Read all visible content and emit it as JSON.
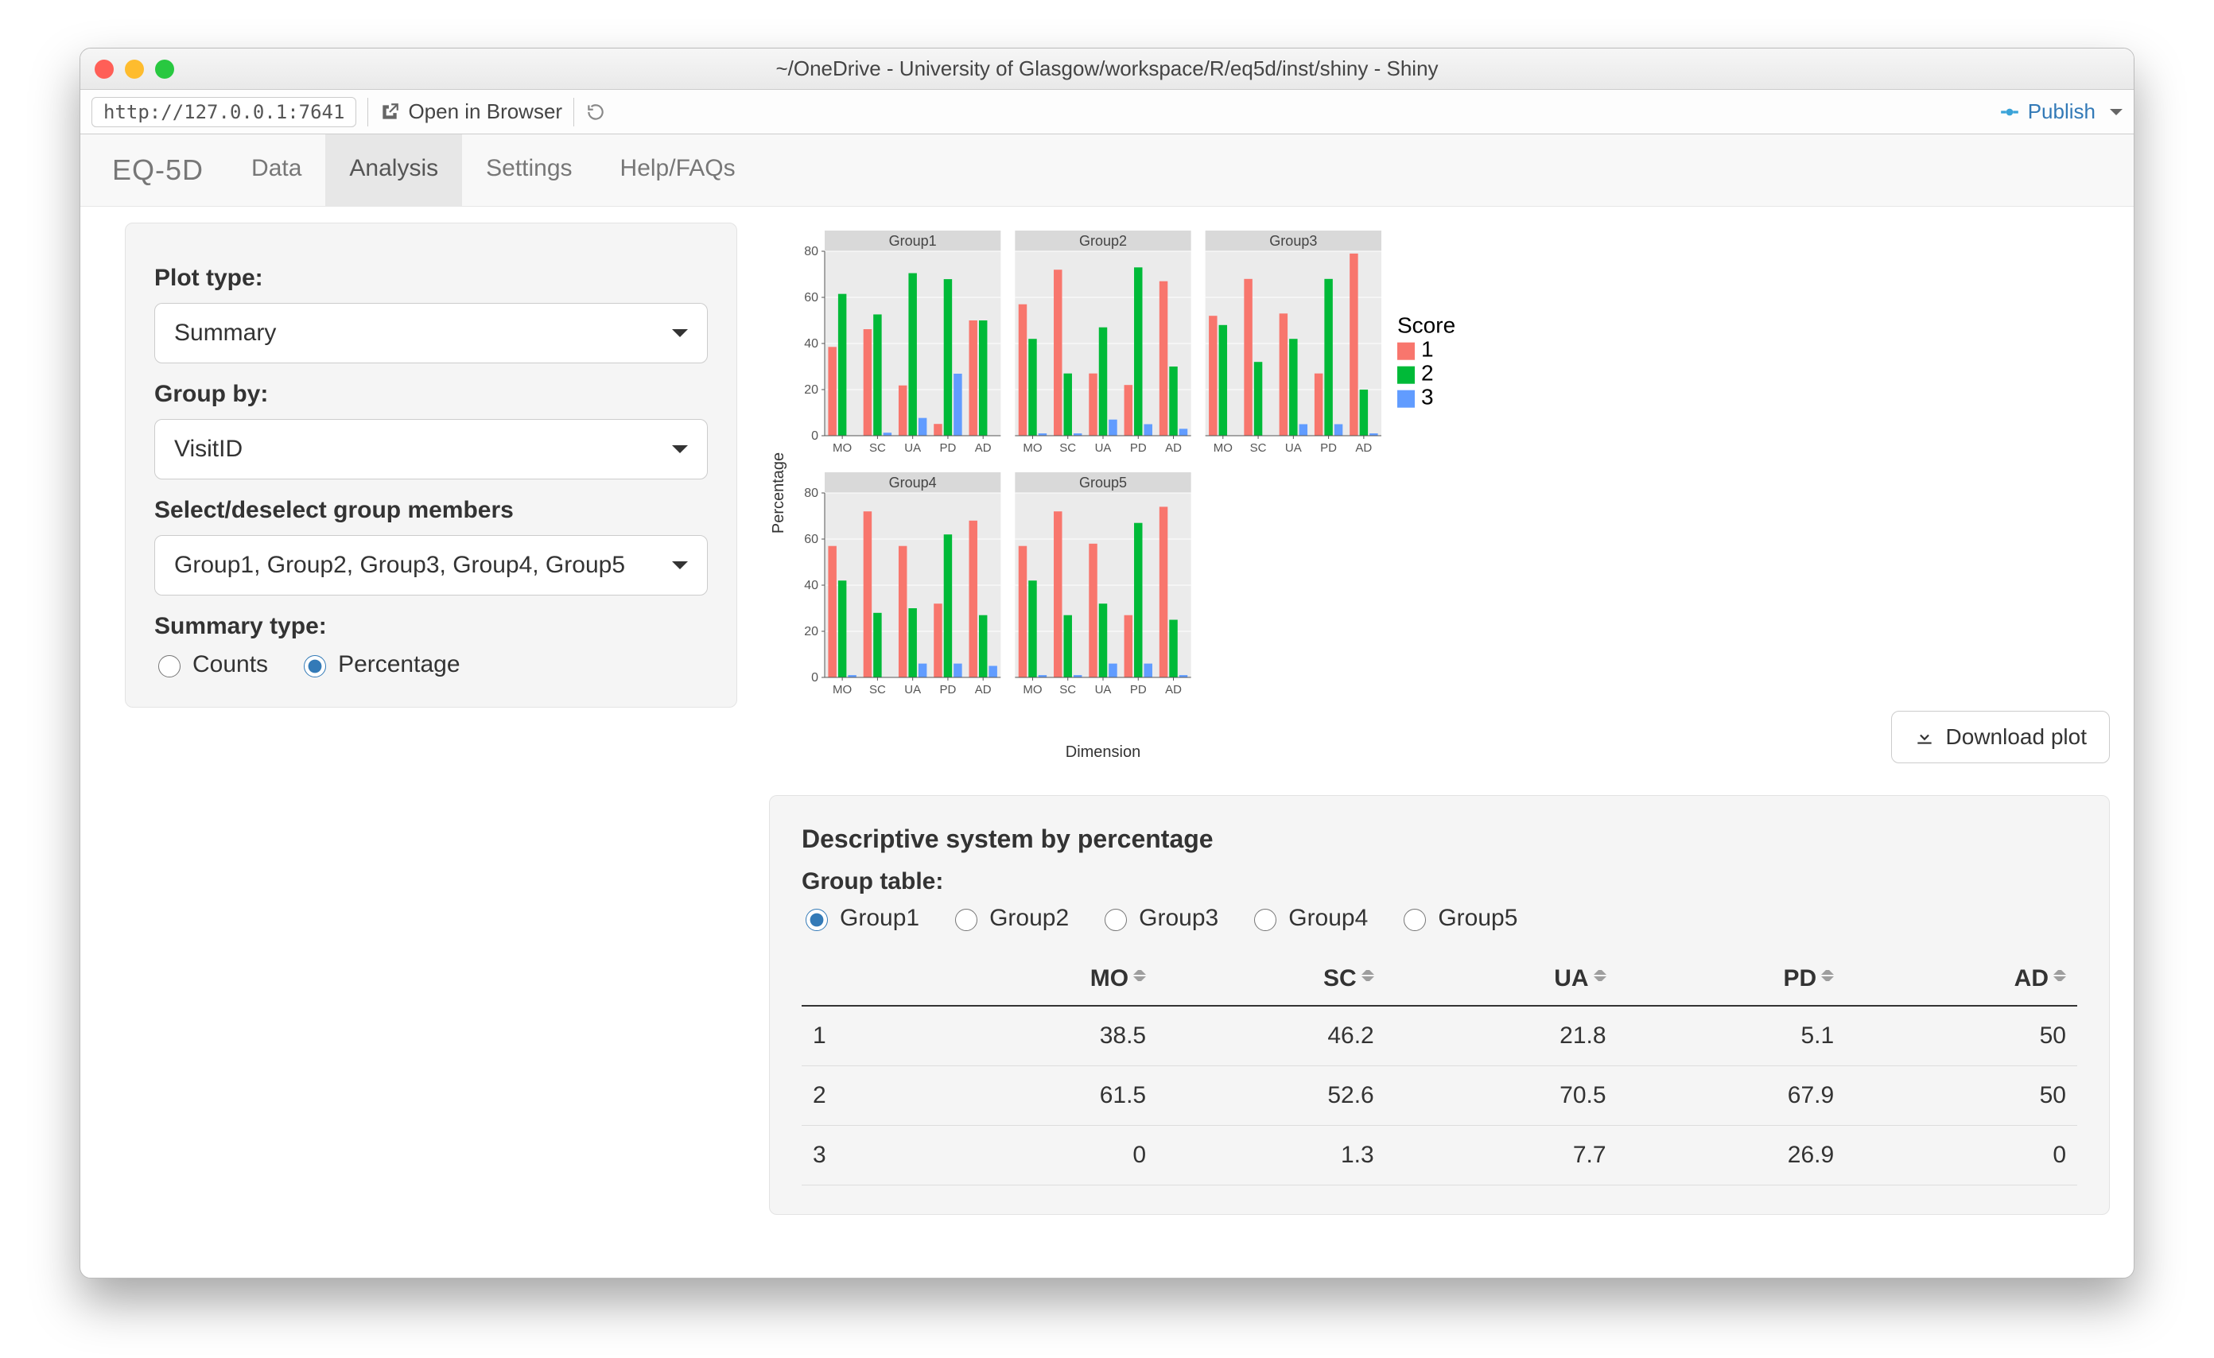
{
  "window": {
    "title": "~/OneDrive - University of Glasgow/workspace/R/eq5d/inst/shiny - Shiny",
    "url": "http://127.0.0.1:7641",
    "open_in_browser": "Open in Browser",
    "publish": "Publish"
  },
  "navbar": {
    "brand": "EQ-5D",
    "tabs": [
      "Data",
      "Analysis",
      "Settings",
      "Help/FAQs"
    ],
    "active_index": 1
  },
  "sidebar": {
    "plot_type": {
      "label": "Plot type:",
      "value": "Summary"
    },
    "group_by": {
      "label": "Group by:",
      "value": "VisitID"
    },
    "members": {
      "label": "Select/deselect group members",
      "value": "Group1, Group2, Group3, Group4, Group5"
    },
    "summary_type": {
      "label": "Summary type:",
      "options": [
        "Counts",
        "Percentage"
      ],
      "selected": "Percentage"
    }
  },
  "download_plot_label": "Download plot",
  "table_panel": {
    "title": "Descriptive system by percentage",
    "group_label": "Group table:",
    "groups": [
      "Group1",
      "Group2",
      "Group3",
      "Group4",
      "Group5"
    ],
    "selected_group": "Group1",
    "columns": [
      "",
      "MO",
      "SC",
      "UA",
      "PD",
      "AD"
    ],
    "rows": [
      [
        "1",
        "38.5",
        "46.2",
        "21.8",
        "5.1",
        "50"
      ],
      [
        "2",
        "61.5",
        "52.6",
        "70.5",
        "67.9",
        "50"
      ],
      [
        "3",
        "0",
        "1.3",
        "7.7",
        "26.9",
        "0"
      ]
    ]
  },
  "chart_data": {
    "type": "bar",
    "title": "",
    "xlabel": "Dimension",
    "ylabel": "Percentage",
    "ylim": [
      0,
      80
    ],
    "yticks": [
      0,
      20,
      40,
      60,
      80
    ],
    "categories": [
      "MO",
      "SC",
      "UA",
      "PD",
      "AD"
    ],
    "legend": {
      "title": "Score",
      "labels": [
        "1",
        "2",
        "3"
      ],
      "colors": [
        "#F8766D",
        "#00BA38",
        "#619CFF"
      ]
    },
    "facets": [
      {
        "name": "Group1",
        "series": [
          {
            "name": "1",
            "values": [
              38.5,
              46.2,
              21.8,
              5.1,
              50.0
            ]
          },
          {
            "name": "2",
            "values": [
              61.5,
              52.6,
              70.5,
              67.9,
              50.0
            ]
          },
          {
            "name": "3",
            "values": [
              0.0,
              1.3,
              7.7,
              26.9,
              0.0
            ]
          }
        ]
      },
      {
        "name": "Group2",
        "series": [
          {
            "name": "1",
            "values": [
              57,
              72,
              27,
              22,
              67
            ]
          },
          {
            "name": "2",
            "values": [
              42,
              27,
              47,
              73,
              30
            ]
          },
          {
            "name": "3",
            "values": [
              1,
              1,
              7,
              5,
              3
            ]
          }
        ]
      },
      {
        "name": "Group3",
        "series": [
          {
            "name": "1",
            "values": [
              52,
              68,
              53,
              27,
              79
            ]
          },
          {
            "name": "2",
            "values": [
              48,
              32,
              42,
              68,
              20
            ]
          },
          {
            "name": "3",
            "values": [
              0,
              0,
              5,
              5,
              1
            ]
          }
        ]
      },
      {
        "name": "Group4",
        "series": [
          {
            "name": "1",
            "values": [
              57,
              72,
              57,
              32,
              68
            ]
          },
          {
            "name": "2",
            "values": [
              42,
              28,
              30,
              62,
              27
            ]
          },
          {
            "name": "3",
            "values": [
              1,
              0,
              6,
              6,
              5
            ]
          }
        ]
      },
      {
        "name": "Group5",
        "series": [
          {
            "name": "1",
            "values": [
              57,
              72,
              58,
              27,
              74
            ]
          },
          {
            "name": "2",
            "values": [
              42,
              27,
              32,
              67,
              25
            ]
          },
          {
            "name": "3",
            "values": [
              1,
              1,
              6,
              6,
              1
            ]
          }
        ]
      }
    ]
  }
}
